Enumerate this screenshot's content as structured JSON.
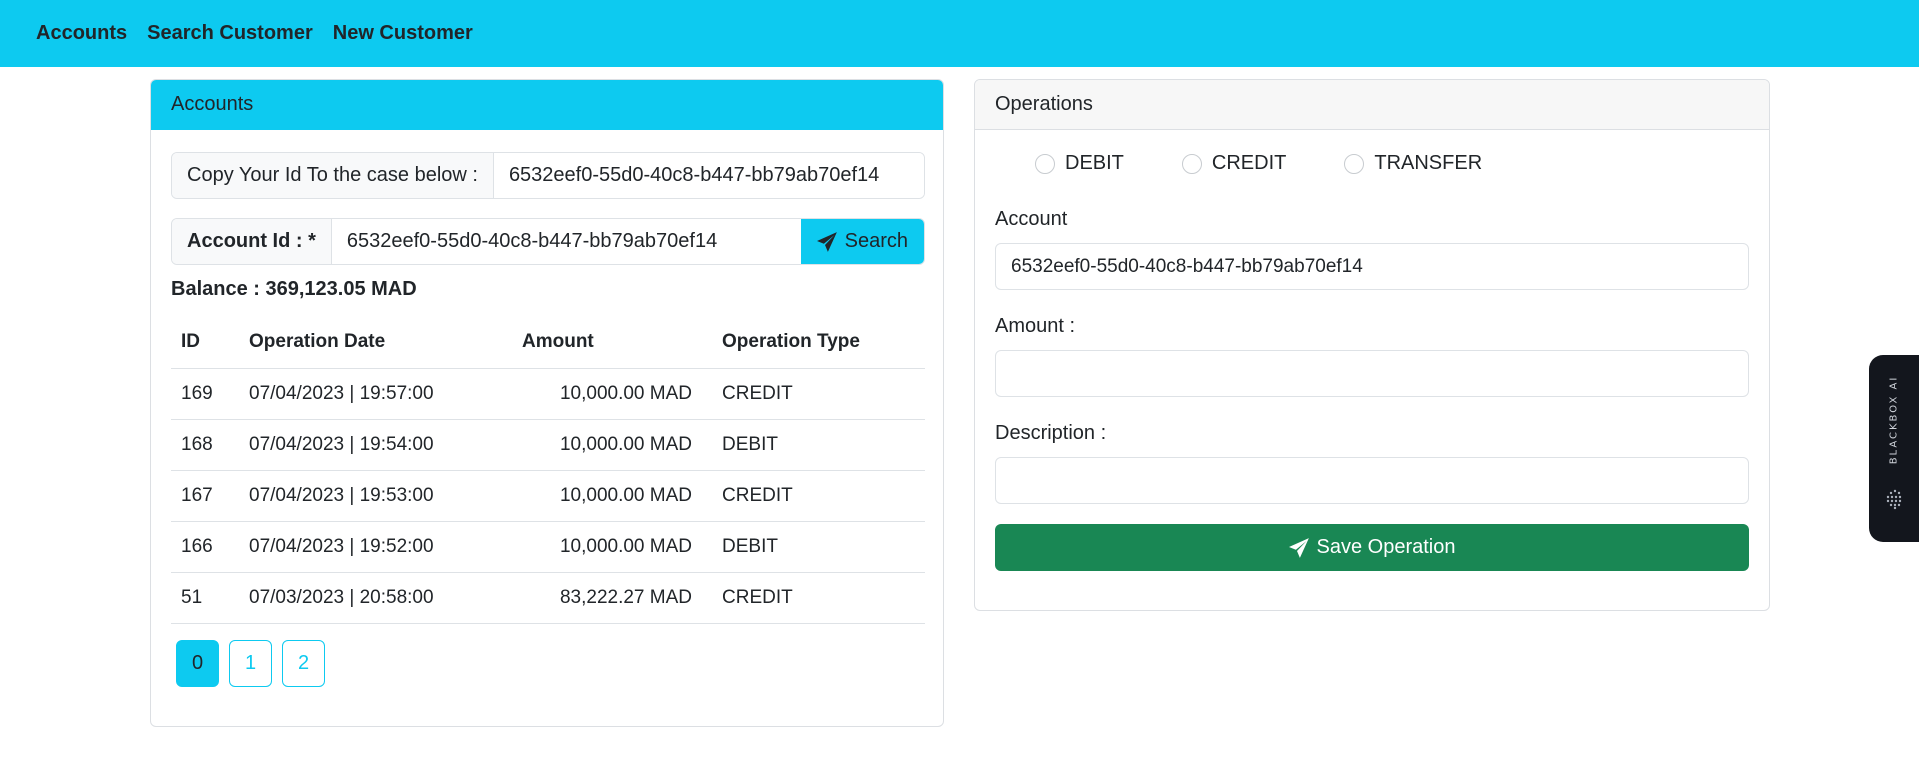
{
  "nav": {
    "items": [
      "Accounts",
      "Search Customer",
      "New Customer"
    ]
  },
  "accounts_card": {
    "title": "Accounts",
    "copy_label": "Copy Your Id To the case below :",
    "copy_value": "6532eef0-55d0-40c8-b447-bb79ab70ef14",
    "account_id_label": "Account Id : *",
    "account_id_value": "6532eef0-55d0-40c8-b447-bb79ab70ef14",
    "search_label": "Search",
    "balance": "Balance : 369,123.05 MAD",
    "table": {
      "columns": [
        "ID",
        "Operation Date",
        "Amount",
        "Operation Type"
      ],
      "rows": [
        [
          "169",
          "07/04/2023 | 19:57:00",
          "10,000.00 MAD",
          "CREDIT"
        ],
        [
          "168",
          "07/04/2023 | 19:54:00",
          "10,000.00 MAD",
          "DEBIT"
        ],
        [
          "167",
          "07/04/2023 | 19:53:00",
          "10,000.00 MAD",
          "CREDIT"
        ],
        [
          "166",
          "07/04/2023 | 19:52:00",
          "10,000.00 MAD",
          "DEBIT"
        ],
        [
          "51",
          "07/03/2023 | 20:58:00",
          "83,222.27 MAD",
          "CREDIT"
        ]
      ]
    },
    "pages": [
      "0",
      "1",
      "2"
    ],
    "active_page": "0"
  },
  "operations_card": {
    "title": "Operations",
    "radio_options": [
      "DEBIT",
      "CREDIT",
      "TRANSFER"
    ],
    "account_label": "Account",
    "account_value": "6532eef0-55d0-40c8-b447-bb79ab70ef14",
    "amount_label": "Amount :",
    "amount_value": "",
    "description_label": "Description :",
    "description_value": "",
    "save_label": "Save Operation"
  },
  "side_widget": {
    "label": "BLACKBOX AI"
  },
  "colors": {
    "info": "#0dcaf0",
    "success": "#198754",
    "widget_bg": "#13161d"
  }
}
